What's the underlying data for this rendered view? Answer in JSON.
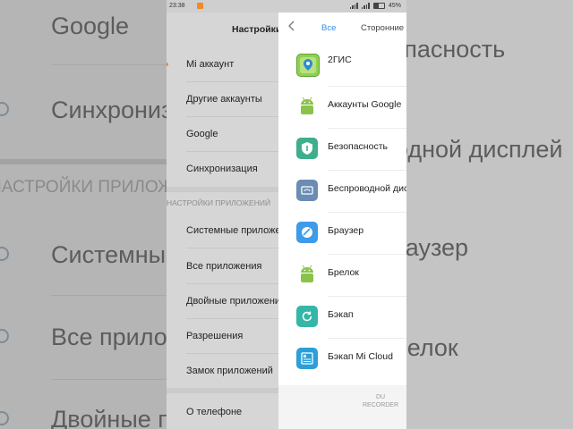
{
  "status_bar": {
    "time": "23:38",
    "battery": "45%"
  },
  "settings": {
    "title": "Настройки",
    "items_top": [
      "Mi аккаунт",
      "Другие аккаунты",
      "Google",
      "Синхронизация"
    ],
    "section": "НАСТРОЙКИ ПРИЛОЖЕНИЙ",
    "items_apps": [
      "Системные приложения",
      "Все приложения",
      "Двойные приложения",
      "Разрешения",
      "Замок приложений"
    ],
    "item_about": "О телефоне"
  },
  "apps_panel": {
    "back_icon": "chevron-left-icon",
    "tab_all": "Все",
    "tab_third_party": "Сторонние",
    "accent": "#2f8ee5",
    "apps": [
      {
        "name": "2ГИС",
        "icon": "2gis-map-icon"
      },
      {
        "name": "Аккаунты Google",
        "icon": "android-icon"
      },
      {
        "name": "Безопасность",
        "icon": "security-shield-icon"
      },
      {
        "name": "Беспроводной дисплей",
        "icon": "wireless-display-icon"
      },
      {
        "name": "Браузер",
        "icon": "browser-icon"
      },
      {
        "name": "Брелок",
        "icon": "android-icon"
      },
      {
        "name": "Бэкап",
        "icon": "backup-icon"
      },
      {
        "name": "Бэкап Mi Cloud",
        "icon": "mi-cloud-backup-icon"
      }
    ]
  },
  "background": {
    "left": [
      "Google",
      "Синхронизация",
      "НАСТРОЙКИ ПРИЛОЖЕНИЙ",
      "Системные приложения",
      "Все приложения",
      "Двойные приложения"
    ],
    "right": [
      "Безопасность",
      "Беспроводной дисплей",
      "Браузер",
      "Брелок"
    ]
  },
  "watermark": {
    "line1": "DU",
    "line2": "RECORDER"
  }
}
